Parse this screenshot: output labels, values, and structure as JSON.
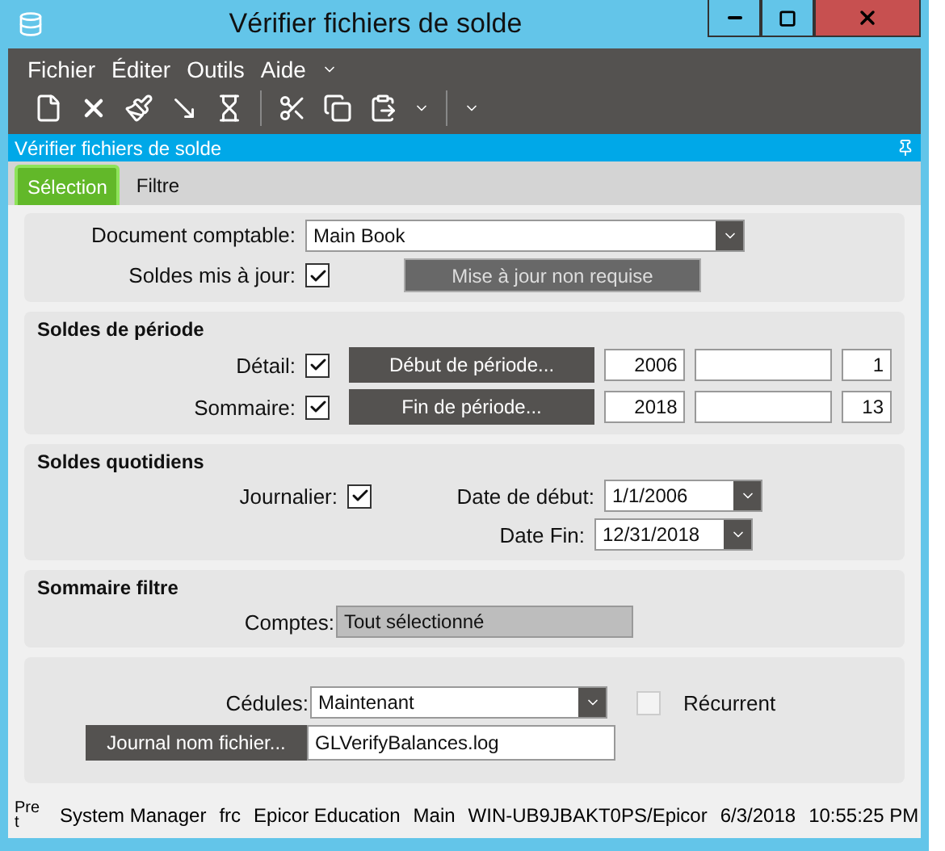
{
  "window": {
    "title": "Vérifier fichiers de solde"
  },
  "menu": [
    "Fichier",
    "Éditer",
    "Outils",
    "Aide"
  ],
  "panel_title": "Vérifier fichiers de solde",
  "tabs": [
    {
      "label": "Sélection",
      "selected": true
    },
    {
      "label": "Filtre",
      "selected": false
    }
  ],
  "general": {
    "book_label": "Document comptable:",
    "book_value": "Main Book",
    "updated_label": "Soldes mis à jour:",
    "updated_checked": true,
    "update_button": "Mise à jour non requise"
  },
  "period": {
    "title": "Soldes de période",
    "rows": [
      {
        "label": "Détail:",
        "checked": true,
        "button": "Début de période...",
        "year": "2006",
        "period": "1"
      },
      {
        "label": "Sommaire:",
        "checked": true,
        "button": "Fin de période...",
        "year": "2018",
        "period": "13"
      }
    ]
  },
  "daily": {
    "title": "Soldes quotidiens",
    "daily_label": "Journalier:",
    "daily_checked": true,
    "start_label": "Date de début:",
    "start_value": "1/1/2006",
    "end_label": "Date Fin:",
    "end_value": "12/31/2018"
  },
  "filter": {
    "title": "Sommaire filtre",
    "accounts_label": "Comptes:",
    "accounts_value": "Tout sélectionné"
  },
  "schedule": {
    "label": "Cédules:",
    "value": "Maintenant",
    "recurring_label": "Récurrent",
    "recurring_checked": false,
    "log_button": "Journal nom fichier...",
    "log_value": "GLVerifyBalances.log"
  },
  "status_bar": [
    "Pre t",
    "System Manager",
    "frc",
    "Epicor Education",
    "Main",
    "WIN-UB9JBAKT0PS/Epicor",
    "6/3/2018",
    "10:55:25 PM"
  ]
}
